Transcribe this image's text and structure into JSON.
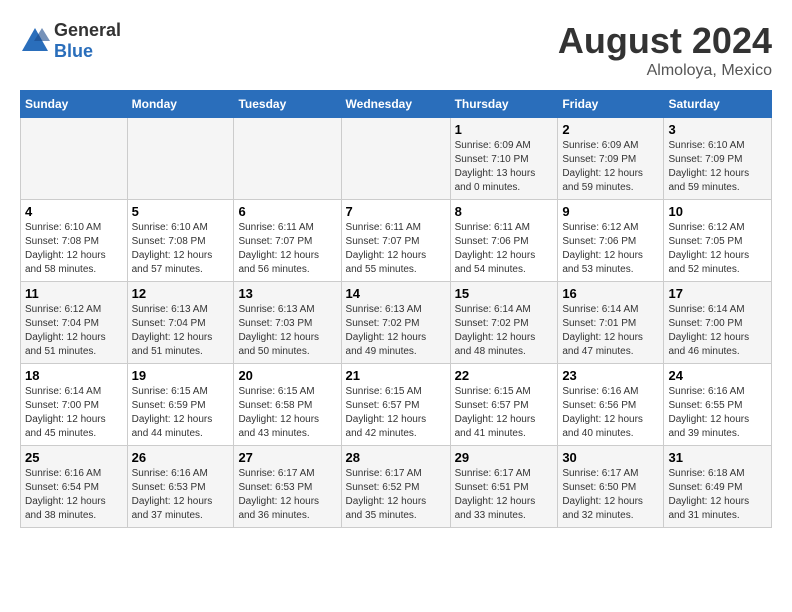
{
  "header": {
    "logo_general": "General",
    "logo_blue": "Blue",
    "month_year": "August 2024",
    "location": "Almoloya, Mexico"
  },
  "weekdays": [
    "Sunday",
    "Monday",
    "Tuesday",
    "Wednesday",
    "Thursday",
    "Friday",
    "Saturday"
  ],
  "weeks": [
    [
      {
        "day": "",
        "info": ""
      },
      {
        "day": "",
        "info": ""
      },
      {
        "day": "",
        "info": ""
      },
      {
        "day": "",
        "info": ""
      },
      {
        "day": "1",
        "info": "Sunrise: 6:09 AM\nSunset: 7:10 PM\nDaylight: 13 hours and 0 minutes."
      },
      {
        "day": "2",
        "info": "Sunrise: 6:09 AM\nSunset: 7:09 PM\nDaylight: 12 hours and 59 minutes."
      },
      {
        "day": "3",
        "info": "Sunrise: 6:10 AM\nSunset: 7:09 PM\nDaylight: 12 hours and 59 minutes."
      }
    ],
    [
      {
        "day": "4",
        "info": "Sunrise: 6:10 AM\nSunset: 7:08 PM\nDaylight: 12 hours and 58 minutes."
      },
      {
        "day": "5",
        "info": "Sunrise: 6:10 AM\nSunset: 7:08 PM\nDaylight: 12 hours and 57 minutes."
      },
      {
        "day": "6",
        "info": "Sunrise: 6:11 AM\nSunset: 7:07 PM\nDaylight: 12 hours and 56 minutes."
      },
      {
        "day": "7",
        "info": "Sunrise: 6:11 AM\nSunset: 7:07 PM\nDaylight: 12 hours and 55 minutes."
      },
      {
        "day": "8",
        "info": "Sunrise: 6:11 AM\nSunset: 7:06 PM\nDaylight: 12 hours and 54 minutes."
      },
      {
        "day": "9",
        "info": "Sunrise: 6:12 AM\nSunset: 7:06 PM\nDaylight: 12 hours and 53 minutes."
      },
      {
        "day": "10",
        "info": "Sunrise: 6:12 AM\nSunset: 7:05 PM\nDaylight: 12 hours and 52 minutes."
      }
    ],
    [
      {
        "day": "11",
        "info": "Sunrise: 6:12 AM\nSunset: 7:04 PM\nDaylight: 12 hours and 51 minutes."
      },
      {
        "day": "12",
        "info": "Sunrise: 6:13 AM\nSunset: 7:04 PM\nDaylight: 12 hours and 51 minutes."
      },
      {
        "day": "13",
        "info": "Sunrise: 6:13 AM\nSunset: 7:03 PM\nDaylight: 12 hours and 50 minutes."
      },
      {
        "day": "14",
        "info": "Sunrise: 6:13 AM\nSunset: 7:02 PM\nDaylight: 12 hours and 49 minutes."
      },
      {
        "day": "15",
        "info": "Sunrise: 6:14 AM\nSunset: 7:02 PM\nDaylight: 12 hours and 48 minutes."
      },
      {
        "day": "16",
        "info": "Sunrise: 6:14 AM\nSunset: 7:01 PM\nDaylight: 12 hours and 47 minutes."
      },
      {
        "day": "17",
        "info": "Sunrise: 6:14 AM\nSunset: 7:00 PM\nDaylight: 12 hours and 46 minutes."
      }
    ],
    [
      {
        "day": "18",
        "info": "Sunrise: 6:14 AM\nSunset: 7:00 PM\nDaylight: 12 hours and 45 minutes."
      },
      {
        "day": "19",
        "info": "Sunrise: 6:15 AM\nSunset: 6:59 PM\nDaylight: 12 hours and 44 minutes."
      },
      {
        "day": "20",
        "info": "Sunrise: 6:15 AM\nSunset: 6:58 PM\nDaylight: 12 hours and 43 minutes."
      },
      {
        "day": "21",
        "info": "Sunrise: 6:15 AM\nSunset: 6:57 PM\nDaylight: 12 hours and 42 minutes."
      },
      {
        "day": "22",
        "info": "Sunrise: 6:15 AM\nSunset: 6:57 PM\nDaylight: 12 hours and 41 minutes."
      },
      {
        "day": "23",
        "info": "Sunrise: 6:16 AM\nSunset: 6:56 PM\nDaylight: 12 hours and 40 minutes."
      },
      {
        "day": "24",
        "info": "Sunrise: 6:16 AM\nSunset: 6:55 PM\nDaylight: 12 hours and 39 minutes."
      }
    ],
    [
      {
        "day": "25",
        "info": "Sunrise: 6:16 AM\nSunset: 6:54 PM\nDaylight: 12 hours and 38 minutes."
      },
      {
        "day": "26",
        "info": "Sunrise: 6:16 AM\nSunset: 6:53 PM\nDaylight: 12 hours and 37 minutes."
      },
      {
        "day": "27",
        "info": "Sunrise: 6:17 AM\nSunset: 6:53 PM\nDaylight: 12 hours and 36 minutes."
      },
      {
        "day": "28",
        "info": "Sunrise: 6:17 AM\nSunset: 6:52 PM\nDaylight: 12 hours and 35 minutes."
      },
      {
        "day": "29",
        "info": "Sunrise: 6:17 AM\nSunset: 6:51 PM\nDaylight: 12 hours and 33 minutes."
      },
      {
        "day": "30",
        "info": "Sunrise: 6:17 AM\nSunset: 6:50 PM\nDaylight: 12 hours and 32 minutes."
      },
      {
        "day": "31",
        "info": "Sunrise: 6:18 AM\nSunset: 6:49 PM\nDaylight: 12 hours and 31 minutes."
      }
    ]
  ]
}
